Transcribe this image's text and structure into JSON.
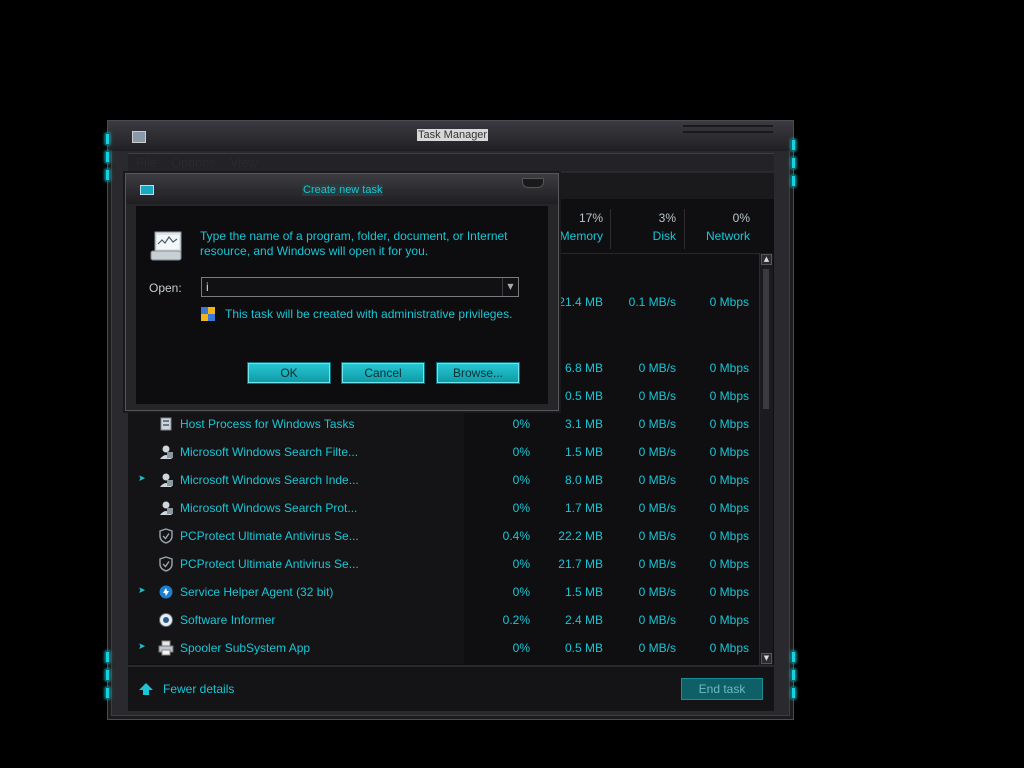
{
  "task_manager": {
    "title": "Task Manager",
    "menu": [
      "File",
      "Options",
      "View"
    ],
    "columns": {
      "cpu": {
        "percent": "",
        "label": ""
      },
      "memory": {
        "percent": "17%",
        "label": "Memory"
      },
      "disk": {
        "percent": "3%",
        "label": "Disk"
      },
      "network": {
        "percent": "0%",
        "label": "Network"
      }
    },
    "partial_rows": [
      {
        "memory": "21.4 MB",
        "disk": "0.1 MB/s",
        "network": "0 Mbps"
      },
      {
        "memory": "6.8 MB",
        "disk": "0 MB/s",
        "network": "0 Mbps"
      },
      {
        "memory": "0.5 MB",
        "disk": "0 MB/s",
        "network": "0 Mbps"
      }
    ],
    "rows": [
      {
        "name": "Host Process for Windows Tasks",
        "cpu": "0%",
        "memory": "3.1 MB",
        "disk": "0 MB/s",
        "network": "0 Mbps",
        "expandable": false,
        "icon": "host-process-icon"
      },
      {
        "name": "Microsoft Windows Search Filte...",
        "cpu": "0%",
        "memory": "1.5 MB",
        "disk": "0 MB/s",
        "network": "0 Mbps",
        "expandable": false,
        "icon": "search-filter-icon"
      },
      {
        "name": "Microsoft Windows Search Inde...",
        "cpu": "0%",
        "memory": "8.0 MB",
        "disk": "0 MB/s",
        "network": "0 Mbps",
        "expandable": true,
        "icon": "search-indexer-icon"
      },
      {
        "name": "Microsoft Windows Search Prot...",
        "cpu": "0%",
        "memory": "1.7 MB",
        "disk": "0 MB/s",
        "network": "0 Mbps",
        "expandable": false,
        "icon": "search-protocol-icon"
      },
      {
        "name": "PCProtect Ultimate Antivirus Se...",
        "cpu": "0.4%",
        "memory": "22.2 MB",
        "disk": "0 MB/s",
        "network": "0 Mbps",
        "expandable": false,
        "icon": "shield-icon"
      },
      {
        "name": "PCProtect Ultimate Antivirus Se...",
        "cpu": "0%",
        "memory": "21.7 MB",
        "disk": "0 MB/s",
        "network": "0 Mbps",
        "expandable": false,
        "icon": "shield-icon"
      },
      {
        "name": "Service Helper Agent (32 bit)",
        "cpu": "0%",
        "memory": "1.5 MB",
        "disk": "0 MB/s",
        "network": "0 Mbps",
        "expandable": true,
        "icon": "service-helper-icon"
      },
      {
        "name": "Software Informer",
        "cpu": "0.2%",
        "memory": "2.4 MB",
        "disk": "0 MB/s",
        "network": "0 Mbps",
        "expandable": false,
        "icon": "software-informer-icon"
      },
      {
        "name": "Spooler SubSystem App",
        "cpu": "0%",
        "memory": "0.5 MB",
        "disk": "0 MB/s",
        "network": "0 Mbps",
        "expandable": true,
        "icon": "printer-icon"
      }
    ],
    "footer": {
      "fewer_details": "Fewer details",
      "end_task": "End task"
    }
  },
  "dialog": {
    "title": "Create new task",
    "message": "Type the name of a program, folder, document, or Internet resource, and Windows will open it for you.",
    "open_label": "Open:",
    "open_value": "i",
    "admin_note": "This task will be created with administrative privileges.",
    "buttons": {
      "ok": "OK",
      "cancel": "Cancel",
      "browse": "Browse..."
    }
  },
  "colors": {
    "accent": "#18c6d6",
    "background": "#000000",
    "window": "#2a2a2e"
  }
}
